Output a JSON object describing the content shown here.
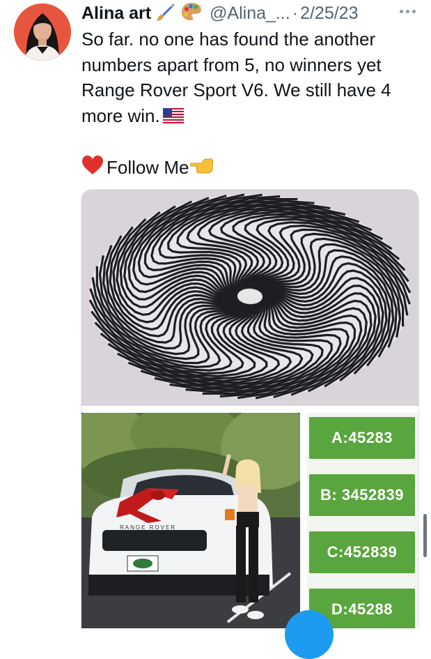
{
  "tweet": {
    "author_name": "Alina art",
    "author_emojis": [
      "paintbrush-icon",
      "palette-icon"
    ],
    "handle": "@Alina_...",
    "separator": "·",
    "date": "2/25/23",
    "text_lines": [
      "So far. no one has found the another",
      "numbers apart from 5, no winners yet",
      "Range Rover Sport V6. We still have 4",
      "more win."
    ],
    "follow_text": "Follow Me"
  },
  "media": {
    "car_plate_text": "RANGE ROVER",
    "codes": [
      {
        "label": "A:45283"
      },
      {
        "label": "B: 3452839"
      },
      {
        "label": "C:452839"
      },
      {
        "label": "D:45288"
      }
    ]
  },
  "colors": {
    "accent_blue": "#1d9bf0",
    "code_green": "#5aa63e",
    "avatar_bg": "#e8553f",
    "muted_text": "#536471"
  }
}
